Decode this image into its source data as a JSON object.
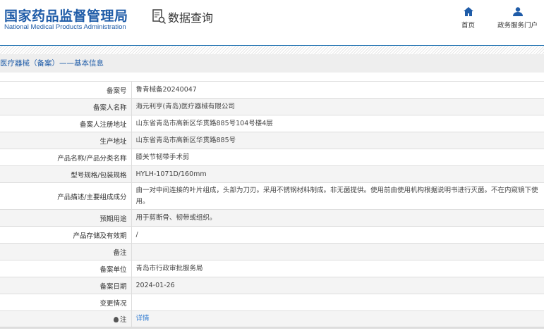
{
  "header": {
    "logo_cn": "国家药品监督管理局",
    "logo_en": "National Medical Products Administration",
    "section_title": "数据查询",
    "nav": [
      {
        "label": "首页",
        "icon": "home-icon"
      },
      {
        "label": "政务服务门户",
        "icon": "user-icon"
      }
    ]
  },
  "breadcrumb": "医疗器械（备案）——基本信息",
  "rows": [
    {
      "label": "备案号",
      "value": "鲁青械备20240047"
    },
    {
      "label": "备案人名称",
      "value": "海元利亨(青岛)医疗器械有限公司"
    },
    {
      "label": "备案人注册地址",
      "value": "山东省青岛市高新区华贯路885号104号楼4层"
    },
    {
      "label": "生产地址",
      "value": "山东省青岛市高新区华贯路885号"
    },
    {
      "label": "产品名称/产品分类名称",
      "value": "膝关节韧带手术剪"
    },
    {
      "label": "型号规格/包装规格",
      "value": "HYLH-1071D/160mm"
    },
    {
      "label": "产品描述/主要组成成分",
      "value": "由一对中间连接的叶片组成，头部为刀刃。采用不锈钢材料制成。非无菌提供。使用前由使用机构根据说明书进行灭菌。不在内窥镜下使用。"
    },
    {
      "label": "预期用途",
      "value": "用于剪断骨、韧带或组织。"
    },
    {
      "label": "产品存储及有效期",
      "value": "/"
    },
    {
      "label": "备注",
      "value": ""
    },
    {
      "label": "备案单位",
      "value": "青岛市行政审批服务局"
    },
    {
      "label": "备案日期",
      "value": "2024-01-26"
    },
    {
      "label": "变更情况",
      "value": ""
    },
    {
      "label": "注",
      "value": "详情"
    }
  ]
}
